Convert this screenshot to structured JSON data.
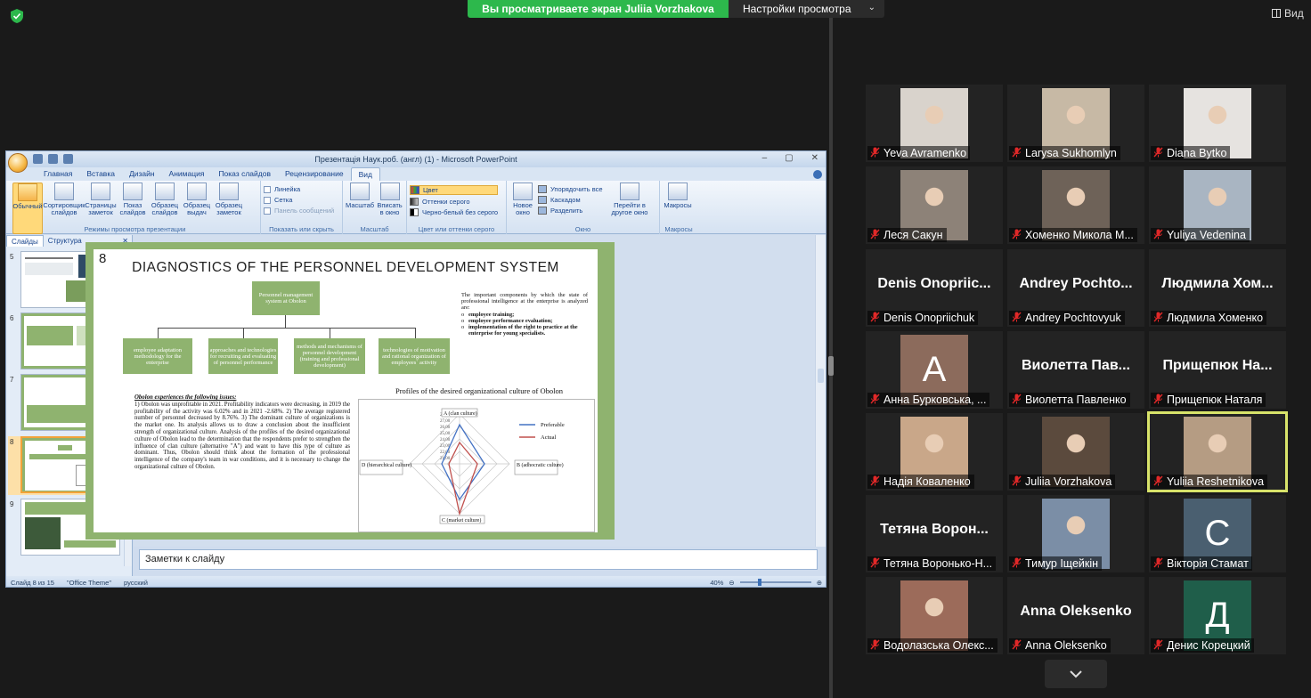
{
  "banner": {
    "sharing_text": "Вы просматриваете экран Juliia Vorzhakova",
    "view_settings": "Настройки просмотра",
    "view_label": "Вид"
  },
  "ppt": {
    "window_title": "Презентація Наук.роб. (англ) (1) - Microsoft PowerPoint",
    "tabs": [
      "Главная",
      "Вставка",
      "Дизайн",
      "Анимация",
      "Показ слайдов",
      "Рецензирование",
      "Вид"
    ],
    "active_tab": "Вид",
    "ribbon": {
      "views_buttons": [
        "Обычный",
        "Сортировщик слайдов",
        "Страницы заметок",
        "Показ слайдов",
        "Образец слайдов",
        "Образец выдач",
        "Образец заметок"
      ],
      "views_label": "Режимы просмотра презентации",
      "show_items": [
        "Линейка",
        "Сетка",
        "Панель сообщений"
      ],
      "show_label": "Показать или скрыть",
      "zoom_buttons": [
        "Масштаб",
        "Вписать в окно"
      ],
      "zoom_label": "Масштаб",
      "color_items": [
        "Цвет",
        "Оттенки серого",
        "Черно-белый без серого"
      ],
      "color_label": "Цвет или оттенки серого",
      "window_buttons": [
        "Новое окно"
      ],
      "window_items": [
        "Упорядочить все",
        "Каскадом",
        "Разделить"
      ],
      "window_switch": "Перейти в другое окно",
      "window_label": "Окно",
      "macros_button": "Макросы",
      "macros_label": "Макросы"
    },
    "pane_tabs": [
      "Слайды",
      "Структура"
    ],
    "thumbnails": [
      "5",
      "6",
      "7",
      "8",
      "9"
    ],
    "selected_thumb": "8",
    "notes_placeholder": "Заметки к слайду",
    "status": {
      "slide": "Слайд 8 из 15",
      "theme": "\"Office Theme\"",
      "lang": "русский",
      "zoom": "40%"
    }
  },
  "slide": {
    "number": "8",
    "title": "DIAGNOSTICS OF THE PERSONNEL DEVELOPMENT SYSTEM",
    "top_box": "Personnel management system at Obolon",
    "boxes": [
      "employee adaptation methodology for the enterprise",
      "approaches and technologies for recruiting and evaluating of personnel performance",
      "methods and mechanisms of personnel development (training and professional development)",
      "technologies of motivation and rational organization of employees` activity"
    ],
    "important_intro": "The important components by which the state of professional intelligence at the enterprise is analyzed are:",
    "important_items": [
      "employee training;",
      "employee performance evaluation;",
      "implementation of the right to practice at the enterprise for young specialists."
    ],
    "issues_title": "Obolon experiences the following issues:",
    "issues_text": "1) Obolon was unprofitable in 2021. Profitability indicators were decreasing, in 2019 the profitability of the activity was 6.02% and in 2021 -2.68%. 2) The average registered number of personnel decreased by 8.76%. 3) The dominant culture of organizations is the market one. Its analysis allows us to draw a conclusion about the insufficient strength of organizational culture. Analysis of the profiles of the desired organizational culture of Obolon lead to the determination that the respondents prefer to strengthen the influence of clan culture (alternative \"A\") and want to have this type of culture as dominant. Thus, Obolon should think about the formation of the professional intelligence of the company's team in war conditions, and it is necessary to change the organizational culture of Obolon.",
    "chart_title": "Profiles of the desired organizational culture of Obolon"
  },
  "chart_data": {
    "type": "radar",
    "title": "Profiles of the desired organizational culture of Obolon",
    "axes": [
      "A (clan culture)",
      "B (adhocratic culture)",
      "C (market culture)",
      "D (hierarchical culture)"
    ],
    "tick_labels": [
      "28,00",
      "27,00",
      "26,00",
      "25,00",
      "24,00",
      "23,00",
      "22,00",
      "21,00"
    ],
    "range": [
      0,
      28
    ],
    "series": [
      {
        "name": "Preferable",
        "color": "#4472c4",
        "values": [
          22,
          14,
          20,
          10
        ]
      },
      {
        "name": "Actual",
        "color": "#c0504d",
        "values": [
          12,
          10,
          28,
          6
        ]
      }
    ],
    "legend": "right"
  },
  "participants": [
    {
      "name": "Yeva Avramenko",
      "kind": "photo",
      "color": "#d9d3cc"
    },
    {
      "name": "Larysa Sukhomlyn",
      "kind": "photo",
      "color": "#c7b9a5"
    },
    {
      "name": "Diana Bytko",
      "kind": "photo",
      "color": "#e6e3e0"
    },
    {
      "name": "Леся Сакун",
      "kind": "photo",
      "color": "#8d8278"
    },
    {
      "name": "Хоменко Микола М...",
      "kind": "photo",
      "color": "#6e6258"
    },
    {
      "name": "Yuliya Vedenina",
      "kind": "photo",
      "color": "#a9b5c2"
    },
    {
      "name": "Denis Onopriichuk",
      "kind": "text",
      "big": "Denis Onopriic..."
    },
    {
      "name": "Andrey Pochtovyuk",
      "kind": "text",
      "big": "Andrey Pochto..."
    },
    {
      "name": "Людмила Хоменко",
      "kind": "text",
      "big": "Людмила Хом..."
    },
    {
      "name": "Анна Бурковська, ...",
      "kind": "letter",
      "letter": "А",
      "color": "#8c6b5c"
    },
    {
      "name": "Виолетта Павленко",
      "kind": "text",
      "big": "Виолетта Пав..."
    },
    {
      "name": "Прищепюк Наталя",
      "kind": "text",
      "big": "Прищепюк На..."
    },
    {
      "name": "Надія Коваленко",
      "kind": "photo",
      "color": "#c9a789"
    },
    {
      "name": "Juliia Vorzhakova",
      "kind": "photo",
      "color": "#5b4a3d"
    },
    {
      "name": "Yuliia Reshetnikova",
      "kind": "photo",
      "color": "#b59c83",
      "active": true
    },
    {
      "name": "Тетяна Воронько-Н...",
      "kind": "text",
      "big": "Тетяна Ворон..."
    },
    {
      "name": "Тимур Іщейкін",
      "kind": "photo",
      "color": "#7b8ea6"
    },
    {
      "name": "Вікторія Стамат",
      "kind": "letter",
      "letter": "С",
      "color": "#4a5f70"
    },
    {
      "name": "Водолазська Олекс...",
      "kind": "photo",
      "color": "#9c6b5a"
    },
    {
      "name": "Anna Oleksenko",
      "kind": "text",
      "big": "Anna Oleksenko"
    },
    {
      "name": "Денис Корецкий",
      "kind": "letter",
      "letter": "Д",
      "color": "#1f5e4a"
    }
  ]
}
